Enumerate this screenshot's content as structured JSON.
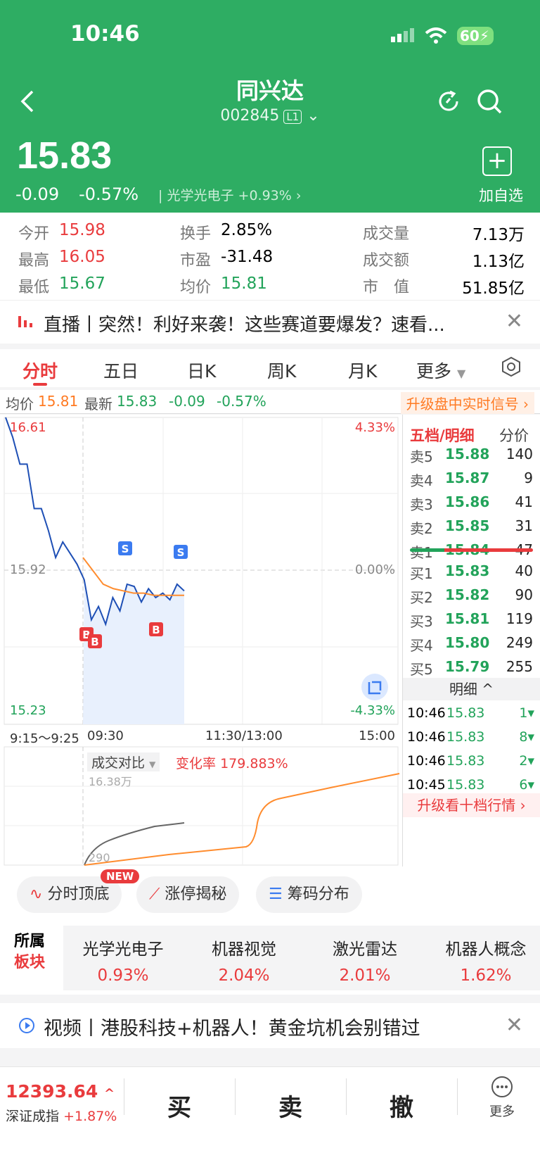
{
  "status": {
    "time": "10:46",
    "battery": "60"
  },
  "header": {
    "title": "同兴达",
    "code": "002845",
    "level": "L1",
    "price": "15.83",
    "change": "-0.09",
    "change_pct": "-0.57%",
    "sector": "光学光电子",
    "sector_pct": "+0.93%",
    "add_label": "加自选"
  },
  "stats": [
    {
      "k": "今开",
      "v": "15.98",
      "color": "red"
    },
    {
      "k": "最高",
      "v": "16.05",
      "color": "red"
    },
    {
      "k": "最低",
      "v": "15.67",
      "color": "green"
    },
    {
      "k": "换手",
      "v": "2.85%",
      "color": "black"
    },
    {
      "k": "市盈",
      "v": "-31.48",
      "color": "black"
    },
    {
      "k": "均价",
      "v": "15.81",
      "color": "green"
    },
    {
      "k": "成交量",
      "v": "7.13万"
    },
    {
      "k": "成交额",
      "v": "1.13亿"
    },
    {
      "k": "市　值",
      "v": "51.85亿"
    }
  ],
  "news": {
    "text": "直播丨突然！利好来袭！这些赛道要爆发？速看..."
  },
  "tabs": [
    "分时",
    "五日",
    "日K",
    "周K",
    "月K",
    "更多"
  ],
  "infobar": {
    "avg_label": "均价",
    "avg": "15.81",
    "latest_label": "最新",
    "latest": "15.83",
    "chg": "-0.09",
    "pct": "-0.57%",
    "upgrade": "升级盘中实时信号"
  },
  "chart_data": {
    "type": "line",
    "y_labels": {
      "top": "16.61",
      "mid": "15.92",
      "bottom": "15.23",
      "top_pct": "4.33%",
      "mid_pct": "0.00%",
      "bottom_pct": "-4.33%"
    },
    "x_labels": [
      "9:15～9:25",
      "09:30",
      "11:30/13:00",
      "15:00"
    ],
    "volume_label": "成交对比",
    "rate_label": "变化率",
    "rate_value": "179.883%",
    "vol_top": "16.38万",
    "vol_bottom": "290",
    "signals": [
      "S",
      "S",
      "B",
      "B",
      "B"
    ],
    "series": [
      {
        "name": "",
        "values": [
          16.61,
          16.52,
          16.4,
          16.4,
          16.2,
          16.2,
          16.1,
          15.98,
          16.05,
          16.0,
          15.95,
          15.88,
          15.7,
          15.76,
          15.68,
          15.8,
          15.74,
          15.86,
          15.85,
          15.78,
          15.84,
          15.8,
          15.82,
          15.79,
          15.86,
          15.83
        ]
      },
      {
        "name": "",
        "values": [
          15.98,
          15.92,
          15.86,
          15.84,
          15.83,
          15.82,
          15.82,
          15.81,
          15.81,
          15.81,
          15.81
        ]
      }
    ]
  },
  "orderbook": {
    "head": "五档/明细",
    "head2": "分价",
    "asks": [
      {
        "l": "卖5",
        "p": "15.88",
        "q": "140"
      },
      {
        "l": "卖4",
        "p": "15.87",
        "q": "9"
      },
      {
        "l": "卖3",
        "p": "15.86",
        "q": "41"
      },
      {
        "l": "卖2",
        "p": "15.85",
        "q": "31"
      },
      {
        "l": "卖1",
        "p": "15.84",
        "q": "47"
      }
    ],
    "bids": [
      {
        "l": "买1",
        "p": "15.83",
        "q": "40"
      },
      {
        "l": "买2",
        "p": "15.82",
        "q": "90"
      },
      {
        "l": "买3",
        "p": "15.81",
        "q": "119"
      },
      {
        "l": "买4",
        "p": "15.80",
        "q": "249"
      },
      {
        "l": "买5",
        "p": "15.79",
        "q": "255"
      }
    ],
    "detail_label": "明细",
    "ticks": [
      {
        "t": "10:46",
        "p": "15.83",
        "q": "1"
      },
      {
        "t": "10:46",
        "p": "15.83",
        "q": "8"
      },
      {
        "t": "10:46",
        "p": "15.83",
        "q": "2"
      },
      {
        "t": "10:45",
        "p": "15.83",
        "q": "6"
      }
    ],
    "upgrade": "升级看十档行情"
  },
  "tools": [
    "分时顶底",
    "涨停揭秘",
    "筹码分布"
  ],
  "new_tag": "NEW",
  "sectors": {
    "label1": "所属",
    "label2": "板块",
    "items": [
      {
        "n": "光学光电子",
        "p": "0.93%"
      },
      {
        "n": "机器视觉",
        "p": "2.04%"
      },
      {
        "n": "激光雷达",
        "p": "2.01%"
      },
      {
        "n": "机器人概念",
        "p": "1.62%"
      }
    ]
  },
  "video": {
    "text": "视频丨港股科技+机器人！黄金坑机会别错过"
  },
  "bottom": {
    "index_value": "12393.64",
    "index_name": "深证成指",
    "index_pct": "+1.87%",
    "buy": "买",
    "sell": "卖",
    "cancel": "撤",
    "more": "更多"
  }
}
